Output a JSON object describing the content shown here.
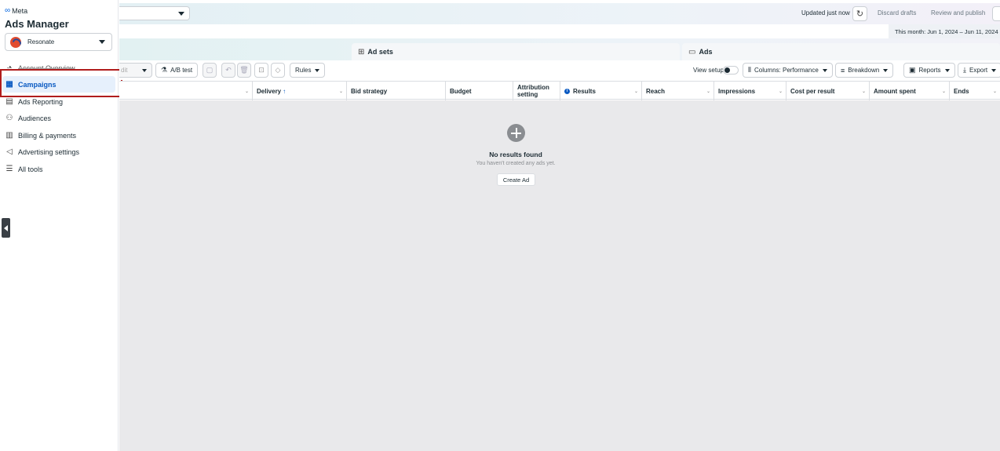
{
  "sidebar": {
    "brand": "Meta",
    "app_title": "Ads Manager",
    "account_name": "Resonate",
    "nav": [
      {
        "label": "Account Overview",
        "icon": "gauge-icon"
      },
      {
        "label": "Campaigns",
        "icon": "grid-icon"
      },
      {
        "label": "Ads Reporting",
        "icon": "report-icon"
      },
      {
        "label": "Audiences",
        "icon": "people-icon"
      },
      {
        "label": "Billing & payments",
        "icon": "billing-icon"
      },
      {
        "label": "Advertising settings",
        "icon": "megaphone-icon"
      },
      {
        "label": "All tools",
        "icon": "menu-icon"
      }
    ],
    "active_item": "Campaigns"
  },
  "topbar": {
    "status": "Updated just now",
    "discard_label": "Discard drafts",
    "review_label": "Review and publish",
    "date_range": "This month: Jun 1, 2024 – Jun 11, 2024"
  },
  "tabs": [
    {
      "label": "Ad sets",
      "icon": "adsets-icon"
    },
    {
      "label": "Ads",
      "icon": "ads-icon"
    }
  ],
  "toolbar": {
    "edit_label": "dit",
    "ab_test_label": "A/B test",
    "rules_label": "Rules",
    "view_setup_label": "View setup",
    "columns_label": "Columns: Performance",
    "breakdown_label": "Breakdown",
    "reports_label": "Reports",
    "export_label": "Export"
  },
  "columns": {
    "delivery": "Delivery",
    "bid_strategy": "Bid strategy",
    "budget": "Budget",
    "attribution_1": "Attribution",
    "attribution_2": "setting",
    "results": "Results",
    "reach": "Reach",
    "impressions": "Impressions",
    "cost_per_result": "Cost per result",
    "amount_spent": "Amount spent",
    "ends": "Ends"
  },
  "empty_state": {
    "title": "No results found",
    "subtitle": "You haven't created any ads yet.",
    "button": "Create Ad"
  },
  "colors": {
    "accent": "#0a5ac2",
    "active_bg": "#e6f0fc",
    "highlight": "#b01c1c",
    "grid_bg": "#e9e9eb"
  }
}
